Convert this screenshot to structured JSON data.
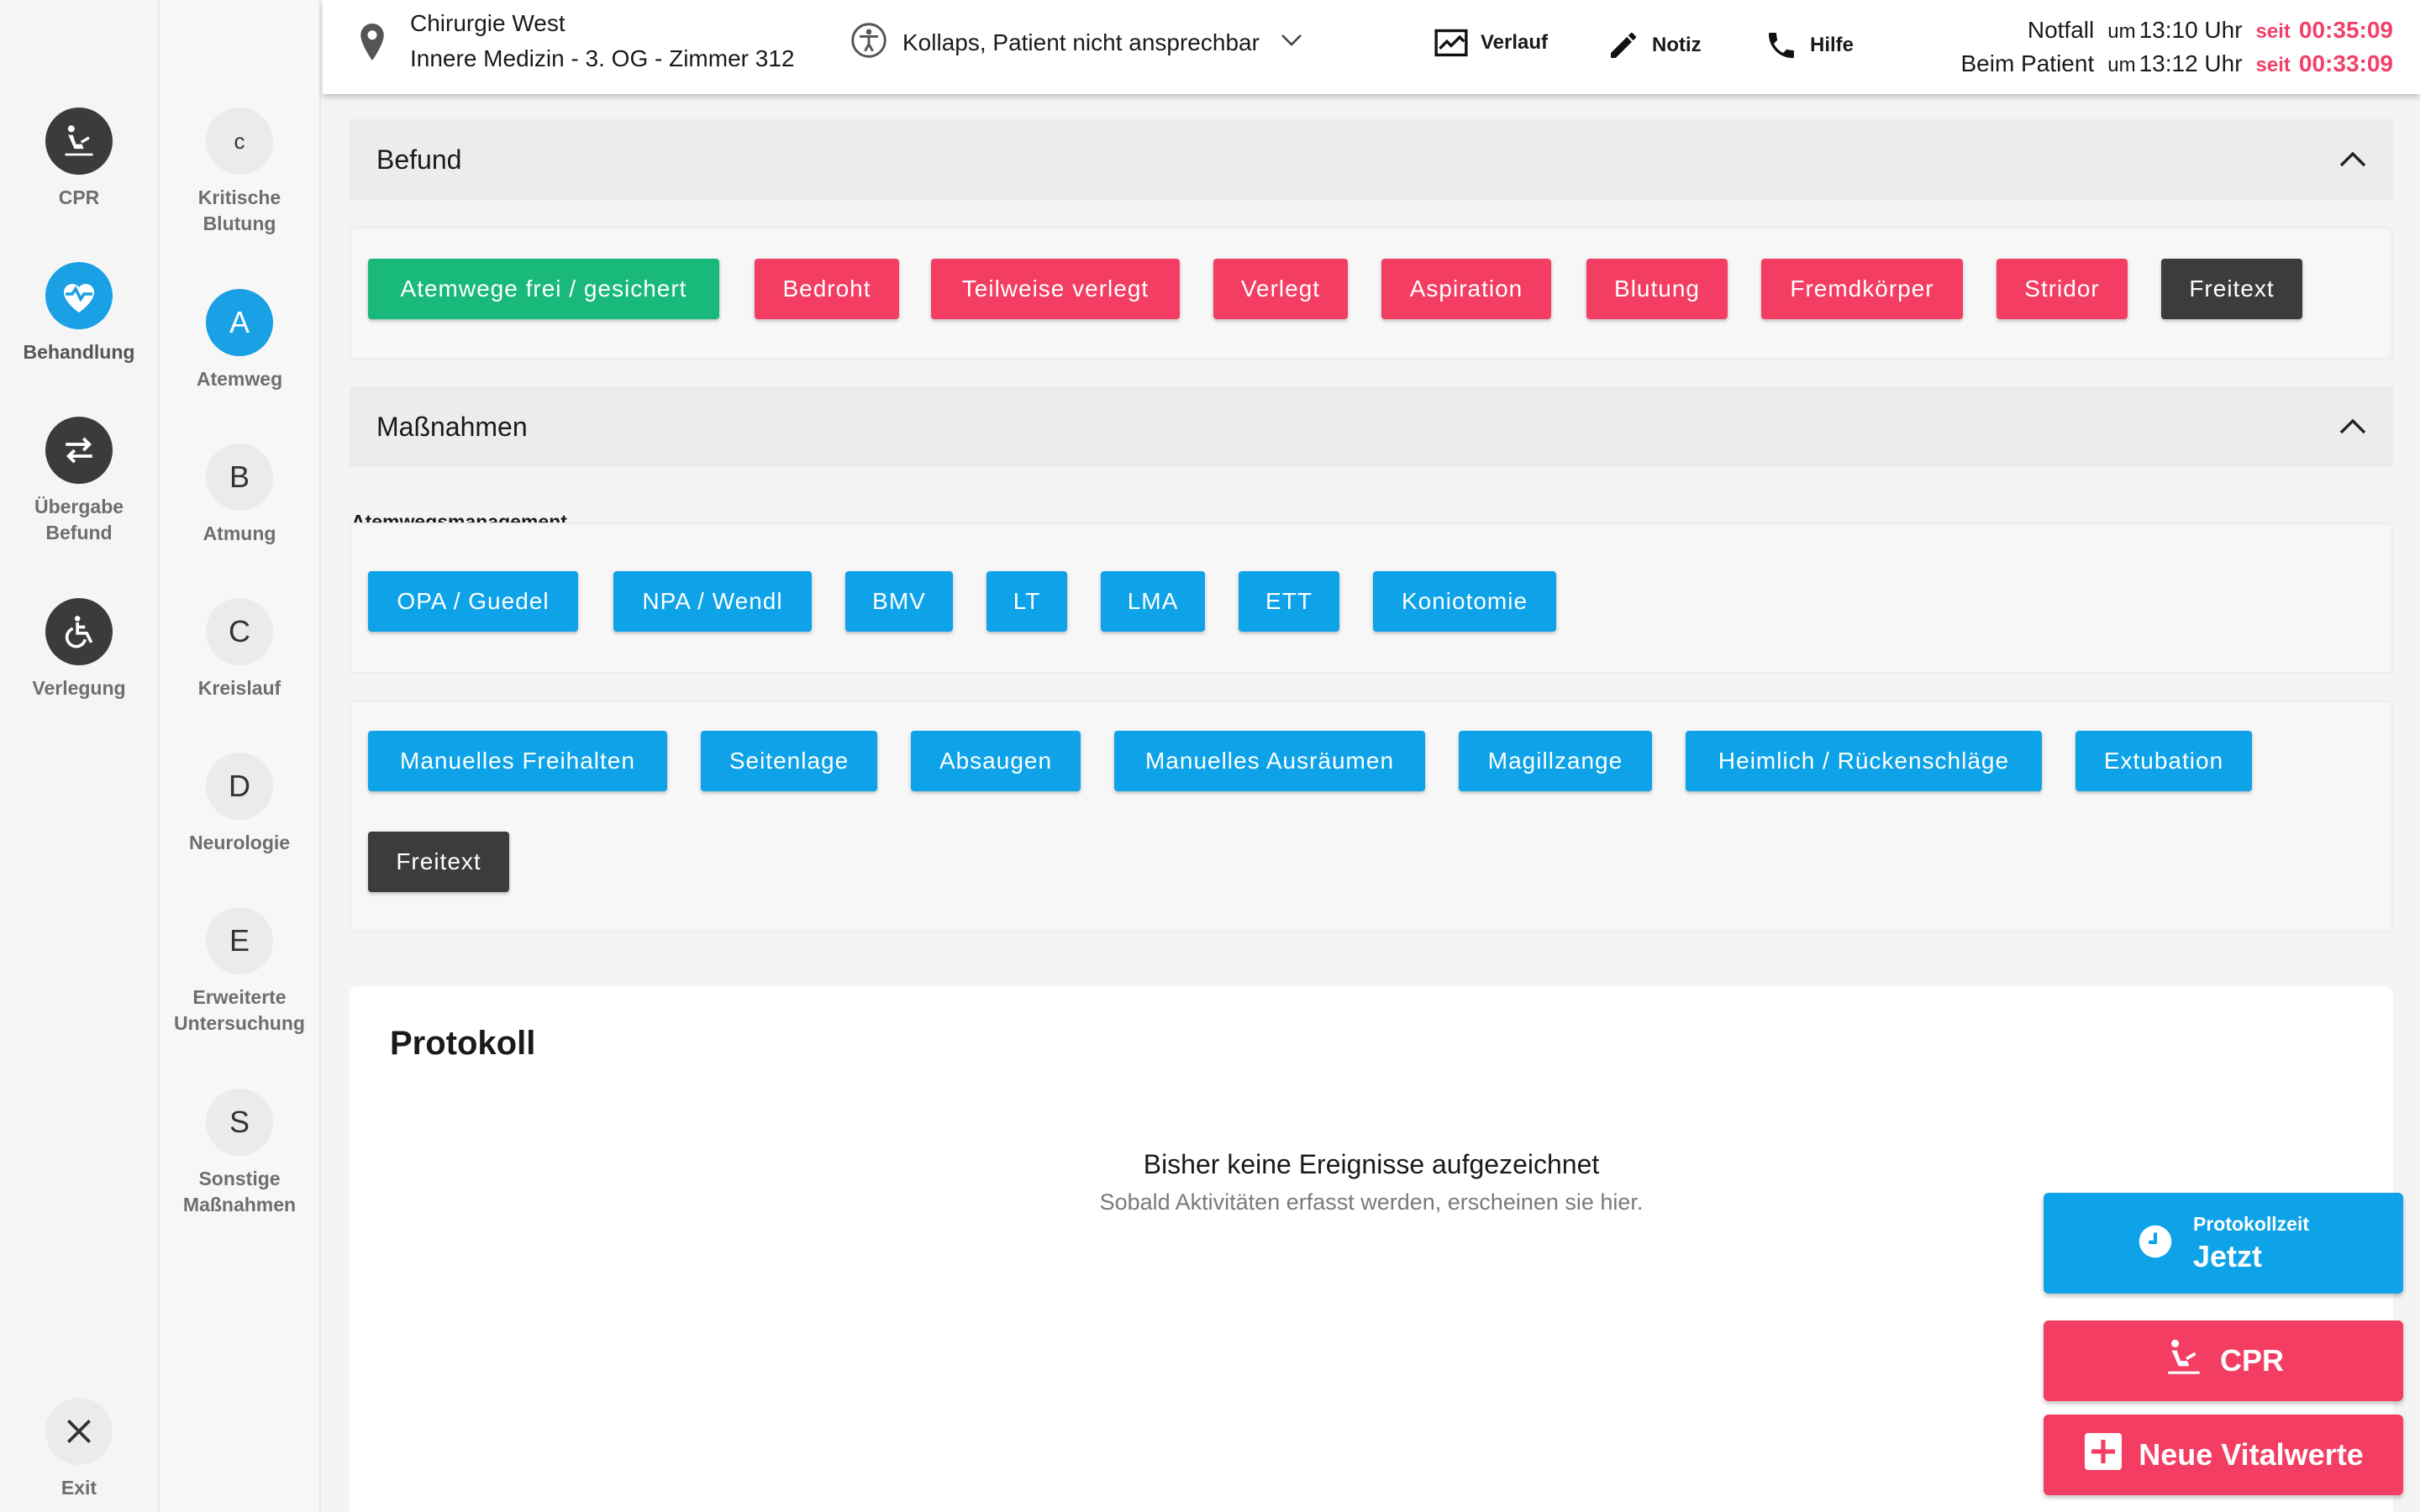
{
  "nav_primary": [
    {
      "label": "CPR",
      "icon": "cpr-icon"
    },
    {
      "label": "Behandlung",
      "icon": "heart-pulse-icon"
    },
    {
      "label": "Übergabe\nBefund",
      "icon": "swap-icon"
    },
    {
      "label": "Verlegung",
      "icon": "wheelchair-icon"
    }
  ],
  "nav_exit": {
    "label": "Exit",
    "icon": "close-icon"
  },
  "nav_abcde": [
    {
      "letter": "c",
      "label": "Kritische\nBlutung"
    },
    {
      "letter": "A",
      "label": "Atemweg",
      "active": true
    },
    {
      "letter": "B",
      "label": "Atmung"
    },
    {
      "letter": "C",
      "label": "Kreislauf"
    },
    {
      "letter": "D",
      "label": "Neurologie"
    },
    {
      "letter": "E",
      "label": "Erweiterte\nUntersuchung"
    },
    {
      "letter": "S",
      "label": "Sonstige\nMaßnahmen"
    }
  ],
  "header": {
    "location_line1": "Chirurgie West",
    "location_line2": "Innere Medizin - 3. OG - Zimmer 312",
    "diagnosis": "Kollaps, Patient nicht ansprechbar",
    "buttons": {
      "verlauf": "Verlauf",
      "notiz": "Notiz",
      "hilfe": "Hilfe"
    },
    "notfall": {
      "label": "Notfall",
      "um": "um",
      "time": "13:10 Uhr",
      "seit": "seit",
      "duration": "00:35:09"
    },
    "patient": {
      "label": "Beim Patient",
      "um": "um",
      "time": "13:12 Uhr",
      "seit": "seit",
      "duration": "00:33:09"
    }
  },
  "befund": {
    "title": "Befund",
    "chips": [
      {
        "label": "Atemwege frei / gesichert",
        "color": "green"
      },
      {
        "label": "Bedroht",
        "color": "red"
      },
      {
        "label": "Teilweise verlegt",
        "color": "red"
      },
      {
        "label": "Verlegt",
        "color": "red"
      },
      {
        "label": "Aspiration",
        "color": "red"
      },
      {
        "label": "Blutung",
        "color": "red"
      },
      {
        "label": "Fremdkörper",
        "color": "red"
      },
      {
        "label": "Stridor",
        "color": "red"
      },
      {
        "label": "Freitext",
        "color": "dark"
      }
    ]
  },
  "massnahmen": {
    "title": "Maßnahmen",
    "subheading": "Atemwegsmanagement",
    "management_chips": [
      "OPA / Guedel",
      "NPA / Wendl",
      "BMV",
      "LT",
      "LMA",
      "ETT",
      "Koniotomie"
    ],
    "other_chips": [
      "Manuelles Freihalten",
      "Seitenlage",
      "Absaugen",
      "Manuelles Ausräumen",
      "Magillzange",
      "Heimlich / Rückenschläge",
      "Extubation"
    ],
    "freitext": "Freitext"
  },
  "protokoll": {
    "title": "Protokoll",
    "empty_title": "Bisher keine Ereignisse aufgezeichnet",
    "empty_sub": "Sobald Aktivitäten erfasst werden, erscheinen sie hier."
  },
  "fab": {
    "time_small": "Protokollzeit",
    "time_big": "Jetzt",
    "cpr": "CPR",
    "vital": "Neue Vitalwerte"
  },
  "colors": {
    "green": "#18b97a",
    "red": "#f33d62",
    "blue": "#0ea3e8",
    "dark": "#3c3c3c",
    "time_red": "#f0416b"
  }
}
